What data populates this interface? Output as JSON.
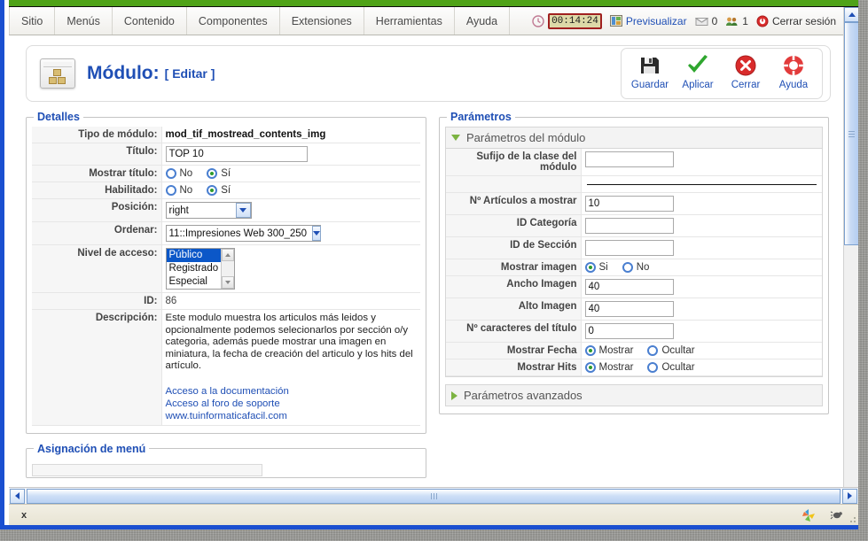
{
  "menubar": {
    "items": [
      {
        "label": "Sitio"
      },
      {
        "label": "Menús"
      },
      {
        "label": "Contenido"
      },
      {
        "label": "Componentes"
      },
      {
        "label": "Extensiones"
      },
      {
        "label": "Herramientas"
      },
      {
        "label": "Ayuda"
      }
    ],
    "timer": "00:14:24",
    "preview_label": "Previsualizar",
    "messages_count": "0",
    "users_count": "1",
    "logout_label": "Cerrar sesión"
  },
  "pagehead": {
    "title": "Módulo:",
    "subtitle": "[ Editar ]",
    "toolbar": [
      {
        "label": "Guardar",
        "icon": "save-icon"
      },
      {
        "label": "Aplicar",
        "icon": "check-icon"
      },
      {
        "label": "Cerrar",
        "icon": "close-icon"
      },
      {
        "label": "Ayuda",
        "icon": "lifering-icon"
      }
    ]
  },
  "details": {
    "legend": "Detalles",
    "labels": {
      "module_type": "Tipo de módulo:",
      "title": "Título:",
      "show_title": "Mostrar título:",
      "enabled": "Habilitado:",
      "position": "Posición:",
      "order": "Ordenar:",
      "access_level": "Nivel de acceso:",
      "id": "ID:",
      "description": "Descripción:"
    },
    "module_type_value": "mod_tif_mostread_contents_img",
    "title_value": "TOP 10",
    "show_title": {
      "no_label": "No",
      "yes_label": "Sí",
      "selected": "Sí"
    },
    "enabled": {
      "no_label": "No",
      "yes_label": "Sí",
      "selected": "Sí"
    },
    "position_value": "right",
    "order_value": "11::Impresiones Web 300_250",
    "access_options": [
      "Público",
      "Registrado",
      "Especial"
    ],
    "access_selected": "Público",
    "id_value": "86",
    "description_value": "Este modulo muestra los articulos más leidos y opcionalmente podemos selecionarlos por sección o/y categoria, además puede mostrar una imagen en miniatura, la fecha de creación del articulo y los hits del artículo.",
    "description_links": [
      "Acceso a la documentación",
      "Acceso al foro de soporte",
      "www.tuinformaticafacil.com"
    ]
  },
  "menu_assignment": {
    "legend": "Asignación de menú"
  },
  "parameters": {
    "legend": "Parámetros",
    "module_params_header": "Parámetros del módulo",
    "advanced_params_header": "Parámetros avanzados",
    "labels": {
      "class_suffix": "Sufijo de la clase del módulo",
      "num_articles": "Nº Artículos a mostrar",
      "category_id": "ID Categoría",
      "section_id": "ID de Sección",
      "show_image": "Mostrar imagen",
      "image_width": "Ancho Imagen",
      "image_height": "Alto Imagen",
      "title_chars": "Nº caracteres del título",
      "show_date": "Mostrar Fecha",
      "show_hits": "Mostrar Hits"
    },
    "class_suffix_value": "",
    "num_articles_value": "10",
    "category_id_value": "",
    "section_id_value": "",
    "show_image": {
      "yes_label": "Si",
      "no_label": "No",
      "selected": "Si"
    },
    "image_width_value": "40",
    "image_height_value": "40",
    "title_chars_value": "0",
    "show_date": {
      "show_label": "Mostrar",
      "hide_label": "Ocultar",
      "selected": "Mostrar"
    },
    "show_hits": {
      "show_label": "Mostrar",
      "hide_label": "Ocultar",
      "selected": "Mostrar"
    }
  },
  "statusbar": {
    "close_mark": "x"
  },
  "colors": {
    "accent_blue": "#1f4fb5",
    "green_bar": "#4fa318",
    "window_border": "#1a4fd0",
    "timer_border": "#a02020",
    "timer_bg": "#ddd9a8"
  }
}
